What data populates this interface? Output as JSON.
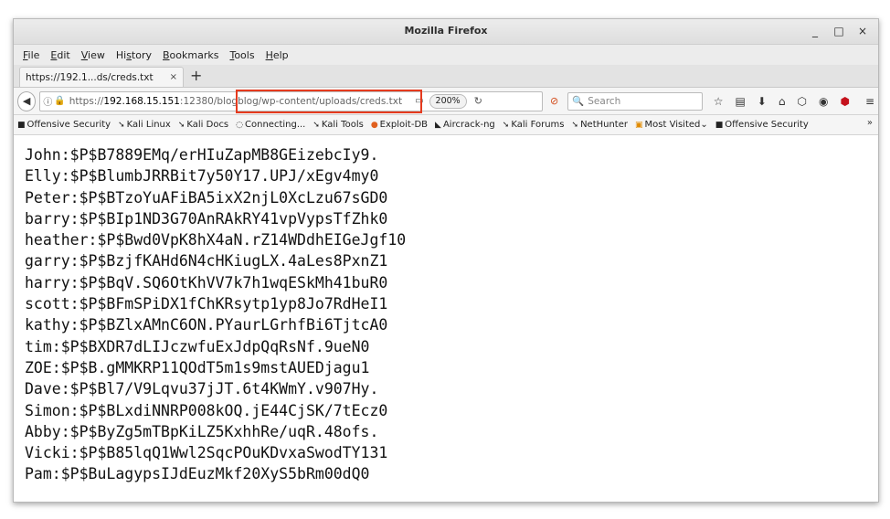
{
  "window": {
    "title": "Mozilla Firefox",
    "minimize": "_",
    "maximize": "□",
    "close": "×"
  },
  "menu": [
    {
      "first": "F",
      "rest": "ile"
    },
    {
      "first": "E",
      "rest": "dit"
    },
    {
      "first": "V",
      "rest": "iew"
    },
    {
      "pre": "Hi",
      "first": "s",
      "rest": "tory"
    },
    {
      "first": "B",
      "rest": "ookmarks"
    },
    {
      "first": "T",
      "rest": "ools"
    },
    {
      "first": "H",
      "rest": "elp"
    }
  ],
  "tab": {
    "title": "https://192.1...ds/creds.txt",
    "close": "×",
    "new": "+"
  },
  "nav": {
    "url_prefix": "https://",
    "url_host": "192.168.15.151",
    "url_port": ":12380",
    "url_path": "/blogblog/wp-content/uploads/creds.txt",
    "zoom": "200%",
    "search_placeholder": "Search"
  },
  "bookmarks": [
    "Offensive Security",
    "Kali Linux",
    "Kali Docs",
    "Connecting...",
    "Kali Tools",
    "Exploit-DB",
    "Aircrack-ng",
    "Kali Forums",
    "NetHunter",
    "Most Visited",
    "Offensive Security"
  ],
  "content_lines": [
    "John:$P$B7889EMq/erHIuZapMB8GEizebcIy9.",
    "Elly:$P$BlumbJRRBit7y50Y17.UPJ/xEgv4my0",
    "Peter:$P$BTzoYuAFiBA5ixX2njL0XcLzu67sGD0",
    "barry:$P$BIp1ND3G70AnRAkRY41vpVypsTfZhk0",
    "heather:$P$Bwd0VpK8hX4aN.rZ14WDdhEIGeJgf10",
    "garry:$P$BzjfKAHd6N4cHKiugLX.4aLes8PxnZ1",
    "harry:$P$BqV.SQ6OtKhVV7k7h1wqESkMh41buR0",
    "scott:$P$BFmSPiDX1fChKRsytp1yp8Jo7RdHeI1",
    "kathy:$P$BZlxAMnC6ON.PYaurLGrhfBi6TjtcA0",
    "tim:$P$BXDR7dLIJczwfuExJdpQqRsNf.9ueN0",
    "ZOE:$P$B.gMMKRP11QOdT5m1s9mstAUEDjagu1",
    "Dave:$P$Bl7/V9Lqvu37jJT.6t4KWmY.v907Hy.",
    "Simon:$P$BLxdiNNRP008kOQ.jE44CjSK/7tEcz0",
    "Abby:$P$ByZg5mTBpKiLZ5KxhhRe/uqR.48ofs.",
    "Vicki:$P$B85lqQ1Wwl2SqcPOuKDvxaSwodTY131",
    "Pam:$P$BuLagypsIJdEuzMkf20XyS5bRm00dQ0"
  ]
}
